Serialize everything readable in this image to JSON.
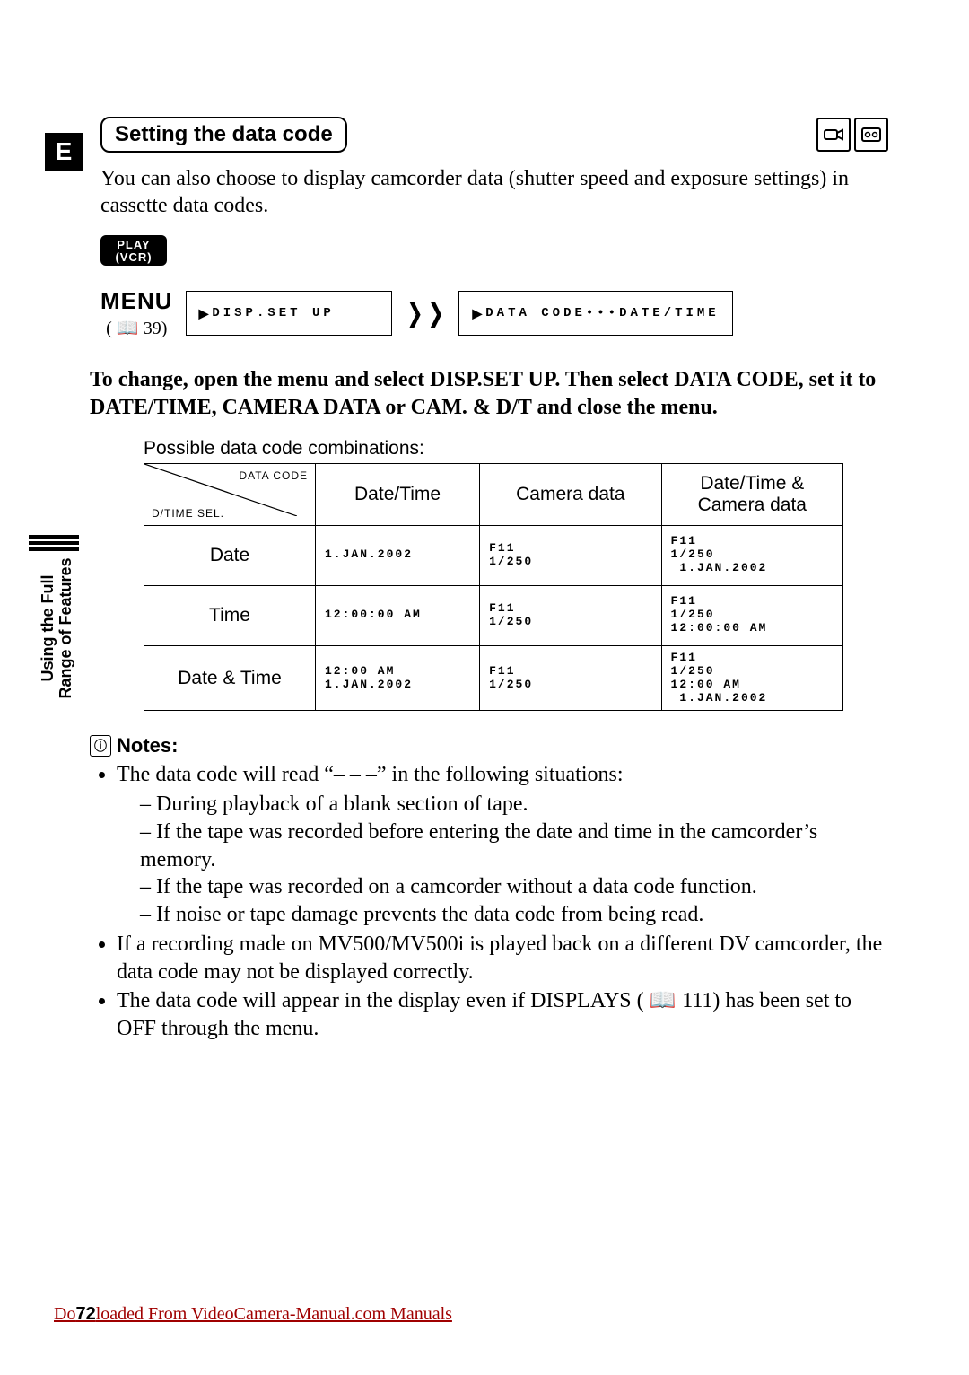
{
  "lang_tab": "E",
  "heading": "Setting the data code",
  "intro": "You can also choose to display camcorder data (shutter speed and exposure settings) in cassette data codes.",
  "play_badge_l1": "PLAY",
  "play_badge_l2": "(VCR)",
  "menu": {
    "label": "MENU",
    "ref": "( 📖 39)",
    "left_box": "DISP.SET UP",
    "right_box": "DATA CODE•••DATE/TIME"
  },
  "instruction": "To change, open the menu and select DISP.SET UP. Then select DATA CODE, set it to DATE/TIME, CAMERA DATA or CAM. & D/T and close the menu.",
  "possible_label": "Possible data code combinations:",
  "table": {
    "corner_top": "DATA CODE",
    "corner_bottom": "D/TIME SEL.",
    "cols": [
      "Date/Time",
      "Camera data",
      "Date/Time &\nCamera data"
    ],
    "rows": [
      {
        "head": "Date",
        "cells": [
          "1.JAN.2002",
          "F11\n1/250",
          "F11\n1/250\n 1.JAN.2002"
        ]
      },
      {
        "head": "Time",
        "cells": [
          "12:00:00 AM",
          "F11\n1/250",
          "F11\n1/250\n12:00:00 AM"
        ]
      },
      {
        "head": "Date & Time",
        "cells": [
          "12:00 AM\n1.JAN.2002",
          "F11\n1/250",
          "F11\n1/250\n12:00 AM\n 1.JAN.2002"
        ]
      }
    ]
  },
  "side_label": "Using the Full\nRange of Features",
  "notes_heading": "Notes:",
  "notes": {
    "n1_lead": "The data code will read “– – –” in the following situations:",
    "n1_subs": [
      "During playback of a blank section of tape.",
      "If the tape was recorded before entering the date and time in the camcorder’s memory.",
      "If the tape was recorded on a camcorder without a data code function.",
      "If noise or tape damage prevents the data code from being read."
    ],
    "n2": "If a recording made on MV500/MV500i is played back on a different DV camcorder, the data code may not be displayed correctly.",
    "n3_a": "The data code will appear in the display even if DISPLAYS ( ",
    "n3_ref": "111",
    "n3_b": ") has been set to OFF through the menu."
  },
  "footer": {
    "page_number": "72",
    "download_text": "Downloaded From VideoCamera-Manual.com Manuals"
  }
}
